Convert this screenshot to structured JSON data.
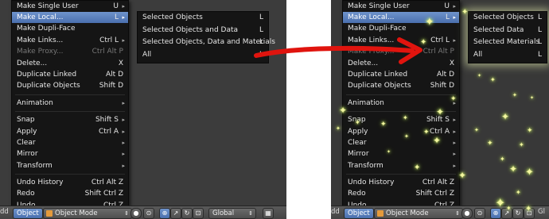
{
  "main_menu": {
    "items": [
      {
        "label": "Make Single User",
        "shortcut": "U",
        "type": "arrow"
      },
      {
        "label": "Make Local...",
        "shortcut": "L",
        "type": "highlight"
      },
      {
        "label": "Make Dupli-Face",
        "shortcut": "",
        "type": "normal"
      },
      {
        "label": "Make Links...",
        "shortcut": "Ctrl L",
        "type": "normal"
      },
      {
        "label": "Make Proxy...",
        "shortcut": "Ctrl Alt P",
        "type": "disabled"
      },
      {
        "label": "Delete...",
        "shortcut": "X",
        "type": "normal"
      },
      {
        "label": "Duplicate Linked",
        "shortcut": "Alt D",
        "type": "normal"
      },
      {
        "label": "Duplicate Objects",
        "shortcut": "Shift D",
        "type": "normal"
      },
      {
        "label": "Animation",
        "shortcut": "",
        "type": "arrow"
      },
      {
        "label": "Snap",
        "shortcut": "Shift S",
        "type": "normal"
      },
      {
        "label": "Apply",
        "shortcut": "Ctrl A",
        "type": "normal"
      },
      {
        "label": "Clear",
        "shortcut": "",
        "type": "arrow"
      },
      {
        "label": "Mirror",
        "shortcut": "",
        "type": "arrow"
      },
      {
        "label": "Transform",
        "shortcut": "",
        "type": "arrow"
      },
      {
        "label": "Undo History",
        "shortcut": "Ctrl Alt Z",
        "type": "normal"
      },
      {
        "label": "Redo",
        "shortcut": "Shift Ctrl Z",
        "type": "normal"
      },
      {
        "label": "Undo",
        "shortcut": "Ctrl Z",
        "type": "normal"
      }
    ]
  },
  "submenu_left": {
    "items": [
      {
        "label": "Selected Objects",
        "shortcut": "L"
      },
      {
        "label": "Selected Objects and Data",
        "shortcut": "L"
      },
      {
        "label": "Selected Objects, Data and Materials",
        "shortcut": "L"
      },
      {
        "label": "All",
        "shortcut": "L"
      }
    ]
  },
  "submenu_right": {
    "items": [
      {
        "label": "Selected Objects",
        "shortcut": "L"
      },
      {
        "label": "Selected Data",
        "shortcut": "L"
      },
      {
        "label": "Selected Materials",
        "shortcut": "L"
      },
      {
        "label": "All",
        "shortcut": "L"
      }
    ]
  },
  "header_left": {
    "edge_text": "dd",
    "object_label": "Object",
    "mode_label": "Object Mode",
    "orientation_label": "Global",
    "trail_text": "Gl"
  },
  "header_right": {
    "edge_text": "dd",
    "object_label": "Object",
    "mode_label": "Object Mode",
    "trail_text": "Gl"
  },
  "colors": {
    "highlight": "#5680c2",
    "menu_bg": "#151515",
    "arrow_red": "#e0140e",
    "sparkle": "#f3f7a0"
  }
}
